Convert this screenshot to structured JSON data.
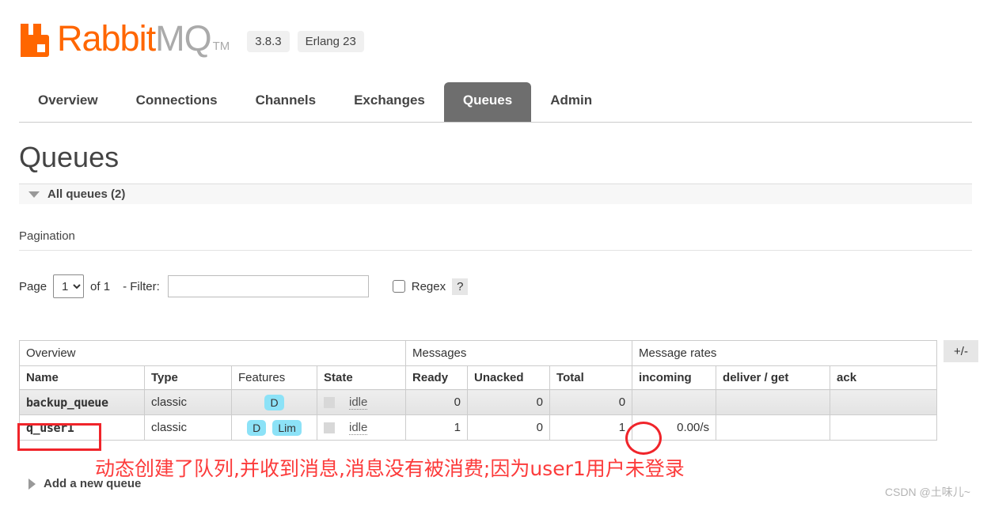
{
  "header": {
    "logo_text_primary": "Rabbit",
    "logo_text_secondary": "MQ",
    "trademark": "TM",
    "version": "3.8.3",
    "erlang": "Erlang 23"
  },
  "nav": {
    "items": [
      {
        "label": "Overview",
        "active": false
      },
      {
        "label": "Connections",
        "active": false
      },
      {
        "label": "Channels",
        "active": false
      },
      {
        "label": "Exchanges",
        "active": false
      },
      {
        "label": "Queues",
        "active": true
      },
      {
        "label": "Admin",
        "active": false
      }
    ]
  },
  "main": {
    "title": "Queues",
    "section_header": "All queues (2)",
    "pagination_label": "Pagination",
    "page_word": "Page",
    "page_value": "1",
    "page_options": [
      "1"
    ],
    "of_text": "of 1",
    "filter_label": "- Filter:",
    "filter_value": "",
    "filter_placeholder": "",
    "regex_label": "Regex",
    "help_label": "?",
    "plus_minus_label": "+/-",
    "add_queue_label": "Add a new queue"
  },
  "table": {
    "group_headers": [
      {
        "label": "Overview",
        "span": 4
      },
      {
        "label": "Messages",
        "span": 3
      },
      {
        "label": "Message rates",
        "span": 3
      }
    ],
    "columns": [
      "Name",
      "Type",
      "Features",
      "State",
      "Ready",
      "Unacked",
      "Total",
      "incoming",
      "deliver / get",
      "ack"
    ],
    "rows": [
      {
        "name": "backup_queue",
        "type": "classic",
        "features": [
          "D"
        ],
        "state": "idle",
        "ready": "0",
        "unacked": "0",
        "total": "0",
        "incoming": "",
        "deliver_get": "",
        "ack": ""
      },
      {
        "name": "q_user1",
        "type": "classic",
        "features": [
          "D",
          "Lim"
        ],
        "state": "idle",
        "ready": "1",
        "unacked": "0",
        "total": "1",
        "incoming": "0.00/s",
        "deliver_get": "",
        "ack": ""
      }
    ]
  },
  "annotations": {
    "note_text": "动态创建了队列,并收到消息,消息没有被消费;因为user1用户未登录",
    "note_color": "#fc3b3b",
    "highlight_color": "#f0242a",
    "watermark": "CSDN @土味儿~"
  },
  "colors": {
    "brand_orange": "#ff6600",
    "active_tab": "#6e6e6e",
    "feature_badge": "#8ce2f7"
  }
}
